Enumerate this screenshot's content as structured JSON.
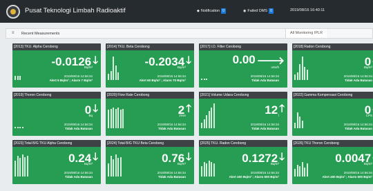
{
  "app": {
    "title": "Pusat Teknologi Limbah Radioaktif",
    "notification_label": "Notification",
    "notification_count": "0",
    "failed_label": "Failed DMS",
    "failed_count": "0",
    "datetime": "2019/08/16 16:40:11"
  },
  "tabs": {
    "recent_label": "Recent Measurements",
    "monitoring_label": "All Monitoring IPLR"
  },
  "cards": [
    {
      "title": "[2013] TKU. Alpha Cerobong",
      "value": "-0.0126",
      "arrow": "down",
      "unit": "Bq/m³",
      "timestamp": "2019/08/16 14:56:34",
      "alert": "Alert 6 Bq/m³ ; Alarm 7 Bq/m³",
      "bars": [
        0.15,
        0.15,
        0.15
      ]
    },
    {
      "title": "[2014] TKU. Beta Cerobong",
      "value": "-0.2034",
      "arrow": "down",
      "unit": "Bq/m³",
      "timestamp": "2019/08/16 14:56:34",
      "alert": "Alert 60 Bq/m³ ; Alarm 70 Bq/m³",
      "bars": [
        0.25,
        0.35,
        0.9,
        0.55,
        0.3
      ]
    },
    {
      "title": "[2017] I.D. Filter Cerobong",
      "value": "0.00",
      "arrow": "right",
      "unit": "uSv/h",
      "timestamp": "2019/08/16 14:56:34",
      "alert": "Tidak Ada Batasan",
      "bars": [
        0.05,
        0.05,
        0.05
      ]
    },
    {
      "title": "[2018] Radon Cerobong",
      "value": "0",
      "arrow": "down",
      "unit": "Bq/m³",
      "timestamp": "2019/08/16 14:56:34",
      "alert": "Tidak Ada Batasan",
      "bars": [
        0.2,
        0.3,
        0.6,
        0.9,
        0.5,
        0.4
      ]
    },
    {
      "title": "[2019] Thoron Cerobong",
      "value": "0",
      "arrow": "down",
      "unit": "Bq",
      "timestamp": "2019/08/16 14:56:34",
      "alert": "Tidak Ada Batasan",
      "bars": [
        0.05,
        0.05,
        0.05,
        0.05
      ]
    },
    {
      "title": "[2020] Flow Rate Cerobong",
      "value": "2",
      "arrow": "up",
      "unit": "l/min",
      "timestamp": "2019/08/16 14:56:34",
      "alert": "Tidak Ada Batasan",
      "bars": [
        0.7,
        0.75,
        0.8,
        0.75,
        0.8,
        0.7,
        0.75
      ]
    },
    {
      "title": "[2021] Volume Udara Cerobong",
      "value": "12",
      "arrow": "up",
      "unit": "l",
      "timestamp": "2019/08/16 14:56:34",
      "alert": "Tidak Ada Batasan",
      "bars": [
        0.2,
        0.35,
        0.5,
        0.65,
        0.8,
        0.95
      ]
    },
    {
      "title": "[2022] Gamma Kompensasi Cerobong",
      "value": "0",
      "arrow": "down",
      "unit": "CPS",
      "timestamp": "2019/08/16 14:56:34",
      "alert": "Tidak Ada Batasan",
      "bars": [
        0.2,
        0.6,
        0.45,
        0.3
      ]
    },
    {
      "title": "[2023] Total B/G TKU Alpha Cerobong",
      "value": "0.24",
      "arrow": "down",
      "unit": "Bq/m³",
      "timestamp": "2019/08/16 14:56:34",
      "alert": "Tidak Ada Batasan",
      "bars": [
        0.6,
        0.8,
        0.7,
        0.85,
        0.75,
        0.8
      ]
    },
    {
      "title": "[2024] Total B/G TKU Beta Cerobong",
      "value": "0.76",
      "arrow": "down",
      "unit": "Bq/m³",
      "timestamp": "2019/08/16 14:56:34",
      "alert": "Tidak Ada Batasan",
      "bars": [
        0.5,
        0.8,
        0.65,
        0.85,
        0.7,
        0.75
      ]
    },
    {
      "title": "[2025] TKU. Radon Cerobong",
      "value": "0.1272",
      "arrow": "down",
      "unit": "Bq/m³",
      "timestamp": "2019/08/16 14:56:34",
      "alert": "Alert 400 Bq/m³ ; Alarm 500 Bq/m³",
      "bars": [
        0.4,
        0.55,
        0.5,
        0.6,
        0.55,
        0.5
      ]
    },
    {
      "title": "[2026] TKU Thoron Cerobong",
      "value": "0.0047",
      "arrow": "down",
      "unit": "Bq/m³",
      "timestamp": "2019/08/16 14:56:34",
      "alert": "Alert 400 Bq/m³ ; Alarm 500 Bq/m³",
      "bars": [
        0.3,
        0.45,
        0.4,
        0.55,
        0.35,
        0.5
      ]
    }
  ]
}
